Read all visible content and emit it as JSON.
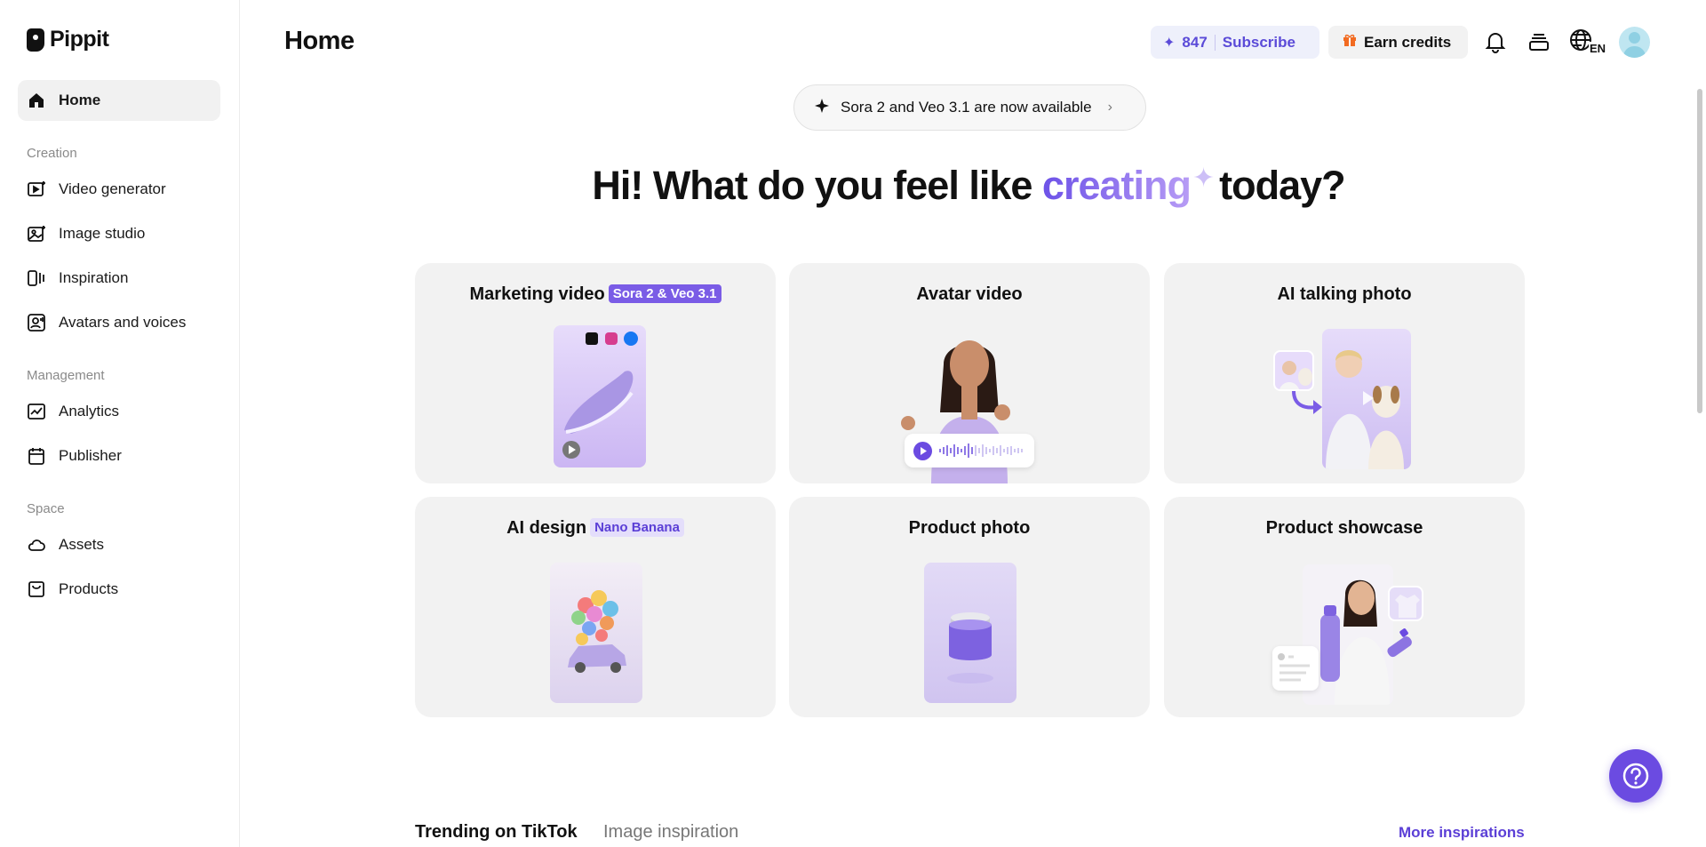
{
  "brand": {
    "name": "Pippit"
  },
  "sidebar": {
    "home": {
      "label": "Home"
    },
    "sections": [
      {
        "label": "Creation",
        "items": [
          {
            "label": "Video generator",
            "icon": "video-generator-icon"
          },
          {
            "label": "Image studio",
            "icon": "image-studio-icon"
          },
          {
            "label": "Inspiration",
            "icon": "inspiration-icon"
          },
          {
            "label": "Avatars and voices",
            "icon": "avatar-voice-icon"
          }
        ]
      },
      {
        "label": "Management",
        "items": [
          {
            "label": "Analytics",
            "icon": "analytics-icon"
          },
          {
            "label": "Publisher",
            "icon": "calendar-icon"
          }
        ]
      },
      {
        "label": "Space",
        "items": [
          {
            "label": "Assets",
            "icon": "cloud-icon"
          },
          {
            "label": "Products",
            "icon": "product-box-icon"
          }
        ]
      }
    ]
  },
  "header": {
    "title": "Home",
    "credits": "847",
    "subscribe_label": "Subscribe",
    "earn_label": "Earn credits",
    "language_code": "EN"
  },
  "announcement": {
    "text": "Sora 2 and Veo 3.1 are now available"
  },
  "hero": {
    "prefix": "Hi! What do you feel like",
    "highlight": "creating",
    "suffix": "today?"
  },
  "cards": [
    {
      "title": "Marketing video",
      "badge": "Sora 2 & Veo 3.1"
    },
    {
      "title": "Avatar video"
    },
    {
      "title": "AI talking photo"
    },
    {
      "title": "AI design",
      "badge": "Nano Banana"
    },
    {
      "title": "Product photo"
    },
    {
      "title": "Product showcase"
    }
  ],
  "bottom_tabs": [
    {
      "label": "Trending on TikTok"
    },
    {
      "label": "Image inspiration"
    }
  ],
  "more_link": "More inspirations",
  "colors": {
    "accent": "#6b4be1",
    "card_bg": "#f2f2f2",
    "credits_bg": "#eef0fb"
  }
}
